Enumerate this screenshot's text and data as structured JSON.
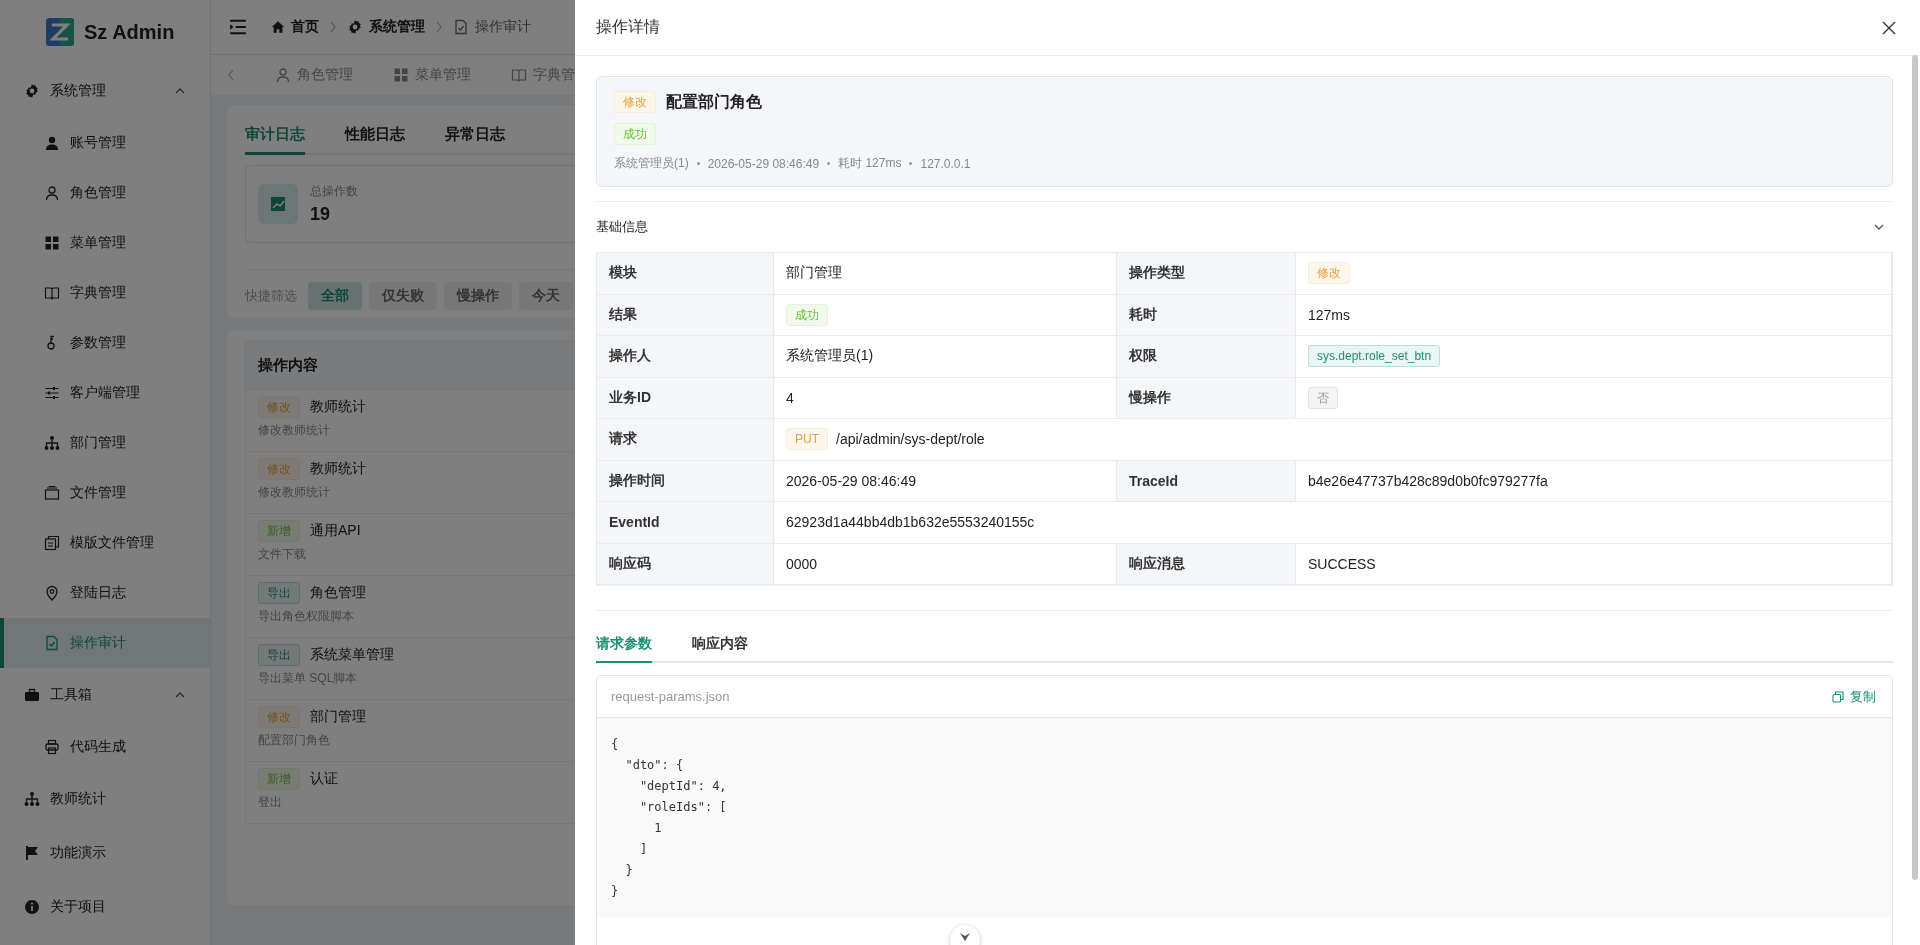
{
  "sidebar": {
    "logo_text": "Sz Admin",
    "items": [
      {
        "label": "系统管理",
        "expanded": true,
        "children": [
          {
            "label": "账号管理",
            "selected": false
          },
          {
            "label": "角色管理",
            "selected": false
          },
          {
            "label": "菜单管理",
            "selected": false
          },
          {
            "label": "字典管理",
            "selected": false
          },
          {
            "label": "参数管理",
            "selected": false
          },
          {
            "label": "客户端管理",
            "selected": false
          },
          {
            "label": "部门管理",
            "selected": false
          },
          {
            "label": "文件管理",
            "selected": false
          },
          {
            "label": "模版文件管理",
            "selected": false
          },
          {
            "label": "登陆日志",
            "selected": false
          },
          {
            "label": "操作审计",
            "selected": true
          }
        ]
      },
      {
        "label": "工具箱",
        "expanded": true,
        "children": [
          {
            "label": "代码生成",
            "selected": false
          }
        ]
      },
      {
        "label": "教师统计"
      },
      {
        "label": "功能演示"
      },
      {
        "label": "关于项目"
      }
    ]
  },
  "breadcrumbs": [
    {
      "label": "首页"
    },
    {
      "label": "系统管理"
    },
    {
      "label": "操作审计"
    }
  ],
  "page_tabs": [
    {
      "label": "角色管理"
    },
    {
      "label": "菜单管理"
    },
    {
      "label": "字典管"
    }
  ],
  "log_tabs": [
    {
      "label": "审计日志",
      "selected": true
    },
    {
      "label": "性能日志",
      "selected": false
    },
    {
      "label": "异常日志",
      "selected": false
    }
  ],
  "stat": {
    "label": "总操作数",
    "value": "19"
  },
  "quick_filter": {
    "label": "快捷筛选",
    "options": [
      {
        "label": "全部",
        "selected": true
      },
      {
        "label": "仅失败",
        "selected": false
      },
      {
        "label": "慢操作",
        "selected": false
      },
      {
        "label": "今天",
        "selected": false
      }
    ]
  },
  "operation_list": {
    "title": "操作内容",
    "rows": [
      {
        "tag": {
          "text": "修改",
          "kind": "update"
        },
        "title": "教师统计",
        "subtitle": "修改教师统计"
      },
      {
        "tag": {
          "text": "修改",
          "kind": "update"
        },
        "title": "教师统计",
        "subtitle": "修改教师统计"
      },
      {
        "tag": {
          "text": "新增",
          "kind": "create"
        },
        "title": "通用API",
        "subtitle": "文件下载"
      },
      {
        "tag": {
          "text": "导出",
          "kind": "export"
        },
        "title": "角色管理",
        "subtitle": "导出角色权限脚本"
      },
      {
        "tag": {
          "text": "导出",
          "kind": "export"
        },
        "title": "系统菜单管理",
        "subtitle": "导出菜单 SQL脚本"
      },
      {
        "tag": {
          "text": "修改",
          "kind": "update"
        },
        "title": "部门管理",
        "subtitle": "配置部门角色"
      },
      {
        "tag": {
          "text": "新增",
          "kind": "create"
        },
        "title": "认证",
        "subtitle": "登出"
      }
    ]
  },
  "drawer": {
    "title": "操作详情",
    "summary": {
      "tag": {
        "text": "修改",
        "kind": "update"
      },
      "title": "配置部门角色",
      "result": {
        "text": "成功",
        "kind": "success"
      },
      "meta": [
        "系统管理员(1)",
        "2026-05-29 08:46:49",
        "耗时 127ms",
        "127.0.0.1"
      ]
    },
    "section": {
      "title": "基础信息",
      "expanded": true
    },
    "rows": [
      {
        "cells": [
          {
            "label": "模块",
            "value": "部门管理",
            "kind": "text"
          },
          {
            "label": "操作类型",
            "kind": "tag",
            "tag": {
              "text": "修改",
              "kind": "update"
            }
          }
        ]
      },
      {
        "cells": [
          {
            "label": "结果",
            "kind": "tag",
            "tag": {
              "text": "成功",
              "kind": "success"
            }
          },
          {
            "label": "耗时",
            "value": "127ms",
            "kind": "text"
          }
        ]
      },
      {
        "cells": [
          {
            "label": "操作人",
            "value": "系统管理员(1)",
            "kind": "text"
          },
          {
            "label": "权限",
            "kind": "tag",
            "tag": {
              "text": "sys.dept.role_set_btn",
              "kind": "permission"
            }
          }
        ]
      },
      {
        "cells": [
          {
            "label": "业务ID",
            "value": "4",
            "kind": "text"
          },
          {
            "label": "慢操作",
            "kind": "tag",
            "tag": {
              "text": "否",
              "kind": "neutral"
            }
          }
        ]
      },
      {
        "cells": [
          {
            "label": "请求",
            "method": "PUT",
            "value": "/api/admin/sys-dept/role",
            "kind": "request"
          }
        ]
      },
      {
        "cells": [
          {
            "label": "操作时间",
            "value": "2026-05-29 08:46:49",
            "kind": "text"
          },
          {
            "label": "TraceId",
            "value": "b4e26e47737b428c89d0b0fc979277fa",
            "kind": "text"
          }
        ]
      },
      {
        "cells": [
          {
            "label": "EventId",
            "value": "62923d1a44bb4db1b632e5553240155c",
            "kind": "text"
          }
        ]
      },
      {
        "cells": [
          {
            "label": "响应码",
            "value": "0000",
            "kind": "text"
          },
          {
            "label": "响应消息",
            "value": "SUCCESS",
            "kind": "text"
          }
        ]
      }
    ],
    "tabs": [
      {
        "label": "请求参数",
        "selected": true
      },
      {
        "label": "响应内容",
        "selected": false
      }
    ],
    "code": {
      "filename": "request-params.json",
      "copy_label": "复制",
      "lines": [
        "{",
        "  \"dto\": {",
        "    \"deptId\": 4,",
        "    \"roleIds\": [",
        "      1",
        "    ]",
        "  }",
        "}"
      ]
    }
  }
}
